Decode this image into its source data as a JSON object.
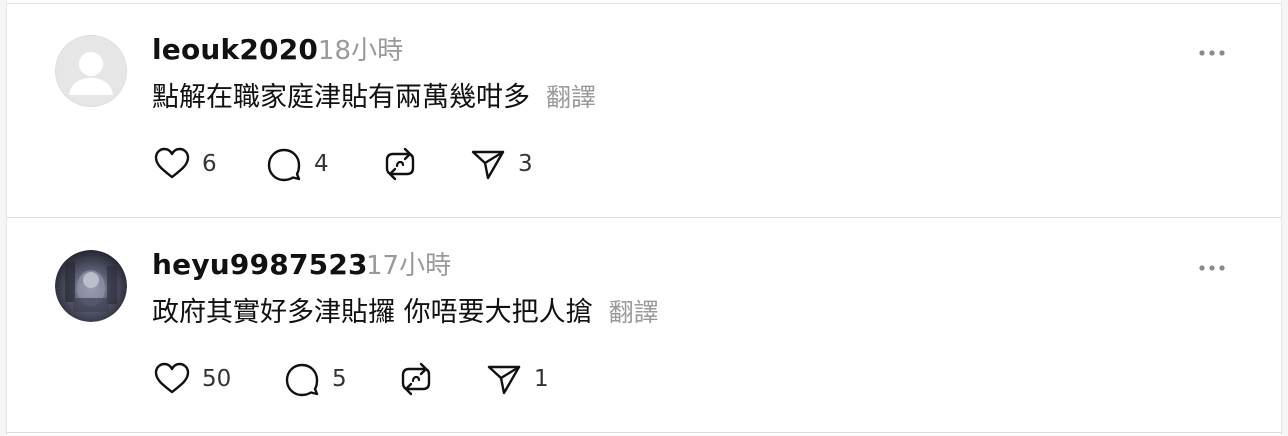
{
  "posts": [
    {
      "username": "leouk2020",
      "time": "18小時",
      "content": "點解在職家庭津貼有兩萬幾咁多",
      "translate_label": "翻譯",
      "likes": "6",
      "replies": "4",
      "shares": "3",
      "avatar": "default-avatar"
    },
    {
      "username": "heyu9987523",
      "time": "17小時",
      "content": "政府其實好多津貼攞 你唔要大把人搶",
      "translate_label": "翻譯",
      "likes": "50",
      "replies": "5",
      "shares": "1",
      "avatar": "photo-avatar"
    }
  ],
  "icons": {
    "like": "heart-icon",
    "reply": "comment-icon",
    "repost": "repost-icon",
    "share": "send-icon",
    "more": "more-dots-icon"
  },
  "colors": {
    "text": "#111111",
    "muted": "#9a9a9a",
    "divider": "#dedede"
  }
}
